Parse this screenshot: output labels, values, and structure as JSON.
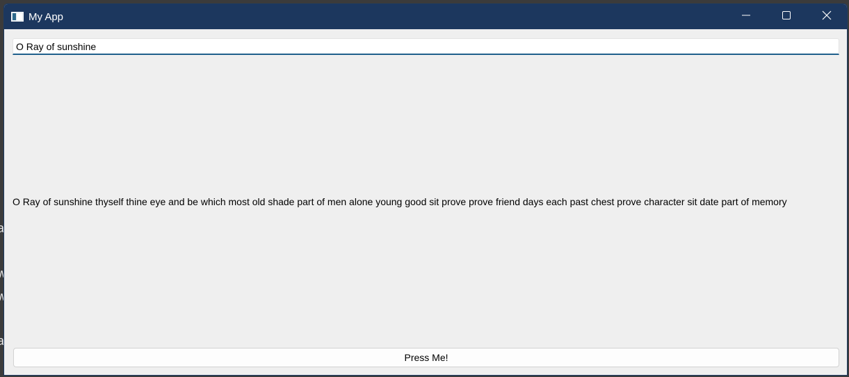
{
  "background_fragments": [
    "a",
    "w",
    "w",
    "a"
  ],
  "window": {
    "title": "My App",
    "app_icon": "app-window-icon",
    "controls": {
      "minimize_icon": "minimize-icon",
      "maximize_icon": "maximize-icon",
      "close_icon": "close-icon"
    }
  },
  "input": {
    "value": "O Ray of sunshine"
  },
  "label": {
    "text": "O Ray of sunshine thyself thine eye and be which most old shade part of men alone young good sit prove prove friend days each past chest prove character sit date part of memory"
  },
  "button": {
    "label": "Press Me!"
  },
  "colors": {
    "titlebar": "#1c375e",
    "window_bg": "#efefef",
    "input_accent": "#1f5f8b"
  }
}
